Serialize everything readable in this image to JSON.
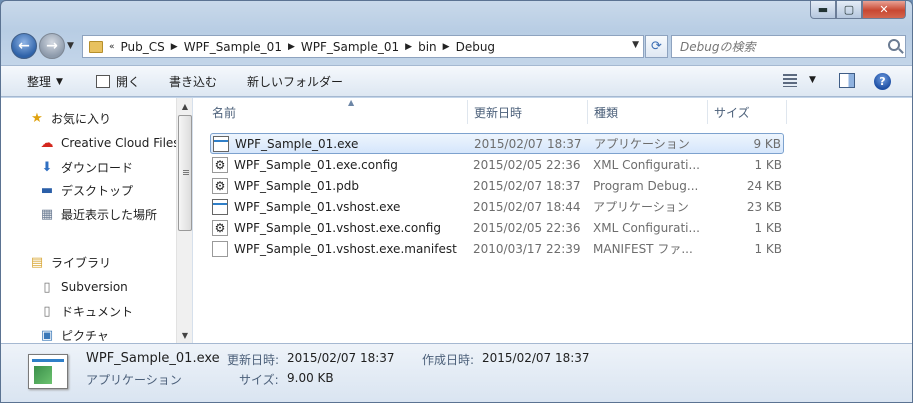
{
  "window": {
    "minimize": "▬",
    "maximize": "▢",
    "close": "✕"
  },
  "nav": {
    "breadcrumb_prefix": "«",
    "crumbs": [
      "Pub_CS",
      "WPF_Sample_01",
      "WPF_Sample_01",
      "bin",
      "Debug"
    ],
    "search_placeholder": "Debugの検索"
  },
  "toolbar": {
    "organize": "整理",
    "open": "開く",
    "burn": "書き込む",
    "new_folder": "新しいフォルダー",
    "help": "?"
  },
  "sidebar": {
    "favorites": "お気に入り",
    "items": [
      "Creative Cloud Files",
      "ダウンロード",
      "デスクトップ",
      "最近表示した場所"
    ],
    "libraries": "ライブラリ",
    "lib_items": [
      "Subversion",
      "ドキュメント",
      "ピクチャ"
    ]
  },
  "columns": {
    "name": "名前",
    "date": "更新日時",
    "type": "種類",
    "size": "サイズ"
  },
  "files": [
    {
      "name": "WPF_Sample_01.exe",
      "date": "2015/02/07 18:37",
      "type": "アプリケーション",
      "size": "9 KB",
      "icon": "exe-icon"
    },
    {
      "name": "WPF_Sample_01.exe.config",
      "date": "2015/02/05 22:36",
      "type": "XML Configurati...",
      "size": "1 KB",
      "icon": "config-icon"
    },
    {
      "name": "WPF_Sample_01.pdb",
      "date": "2015/02/07 18:37",
      "type": "Program Debug...",
      "size": "24 KB",
      "icon": "pdb-icon"
    },
    {
      "name": "WPF_Sample_01.vshost.exe",
      "date": "2015/02/07 18:44",
      "type": "アプリケーション",
      "size": "23 KB",
      "icon": "exe-icon"
    },
    {
      "name": "WPF_Sample_01.vshost.exe.config",
      "date": "2015/02/05 22:36",
      "type": "XML Configurati...",
      "size": "1 KB",
      "icon": "config-icon"
    },
    {
      "name": "WPF_Sample_01.vshost.exe.manifest",
      "date": "2010/03/17 22:39",
      "type": "MANIFEST ファ...",
      "size": "1 KB",
      "icon": "document-icon"
    }
  ],
  "details": {
    "name": "WPF_Sample_01.exe",
    "modified_label": "更新日時:",
    "modified": "2015/02/07 18:37",
    "created_label": "作成日時:",
    "created": "2015/02/07 18:37",
    "type": "アプリケーション",
    "size_label": "サイズ:",
    "size": "9.00 KB"
  }
}
